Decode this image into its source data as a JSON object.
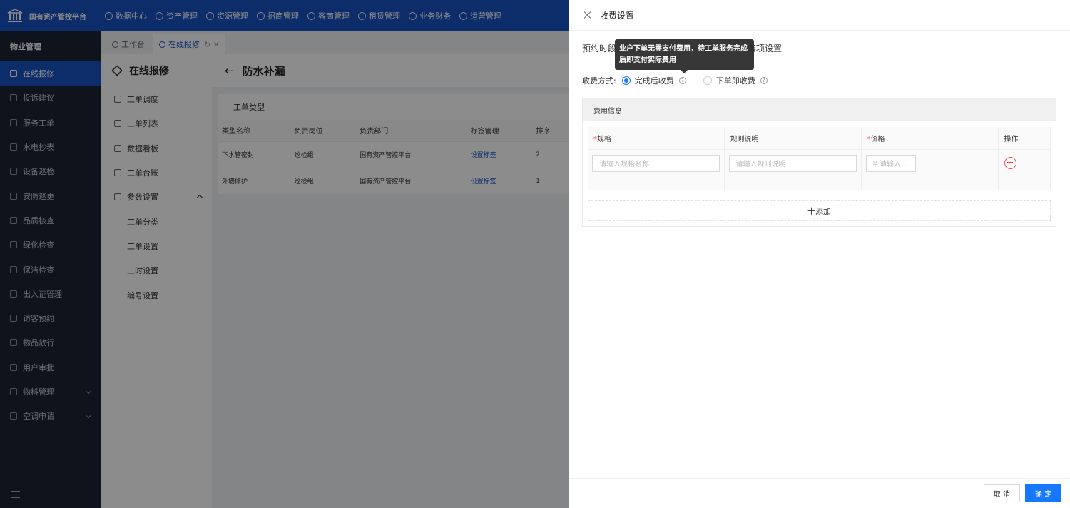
{
  "brand": {
    "name": "国有资产管控平台"
  },
  "topnav": [
    "数据中心",
    "资产管理",
    "资源管理",
    "招商管理",
    "客商管理",
    "租赁管理",
    "业务财务",
    "运营管理"
  ],
  "sidebar": {
    "section": "物业管理",
    "items": [
      {
        "label": "在线报修",
        "active": true
      },
      {
        "label": "投诉建议"
      },
      {
        "label": "服务工单"
      },
      {
        "label": "水电抄表"
      },
      {
        "label": "设备巡检"
      },
      {
        "label": "安防巡更"
      },
      {
        "label": "品质核查"
      },
      {
        "label": "绿化检查"
      },
      {
        "label": "保洁检查"
      },
      {
        "label": "出入证管理"
      },
      {
        "label": "访客预约"
      },
      {
        "label": "物品放行"
      },
      {
        "label": "用户审批"
      },
      {
        "label": "物料管理",
        "expandable": true
      },
      {
        "label": "空调申请",
        "expandable": true
      }
    ]
  },
  "tabs": {
    "workbench": "工作台",
    "current": "在线报修"
  },
  "submenu": {
    "title": "在线报修",
    "items": [
      "工单调度",
      "工单列表",
      "数据看板",
      "工单台账",
      "参数设置"
    ],
    "children": [
      "工单分类",
      "工单设置",
      "工时设置",
      "编号设置"
    ]
  },
  "main": {
    "title": "防水补漏",
    "panel_title": "工单类型",
    "columns": [
      "类型名称",
      "负责岗位",
      "负责部门",
      "标签管理",
      "排序"
    ],
    "rows": [
      [
        "下水管密封",
        "巡检组",
        "国有资产管控平台",
        "设置标签",
        "2"
      ],
      [
        "外墙修护",
        "巡检组",
        "国有资产管控平台",
        "设置标签",
        "1"
      ]
    ]
  },
  "drawer": {
    "title": "收费设置",
    "tab_left": "预约时段",
    "tab_right": "务项设置",
    "tooltip": "业户下单无需支付费用，待工单服务完成后即支付实际费用",
    "charge_label": "收费方式:",
    "options": [
      {
        "label": "完成后收费",
        "selected": true
      },
      {
        "label": "下单即收费",
        "selected": false
      }
    ],
    "fee_title": "费用信息",
    "fee_columns": {
      "spec": "规格",
      "rule": "规则说明",
      "price": "价格",
      "op": "操作"
    },
    "placeholders": {
      "spec": "请输入规格名称",
      "rule": "请输入规则说明",
      "price": "¥ 请输入..."
    },
    "add_label": "十添加",
    "cancel": "取 消",
    "ok": "确 定"
  }
}
